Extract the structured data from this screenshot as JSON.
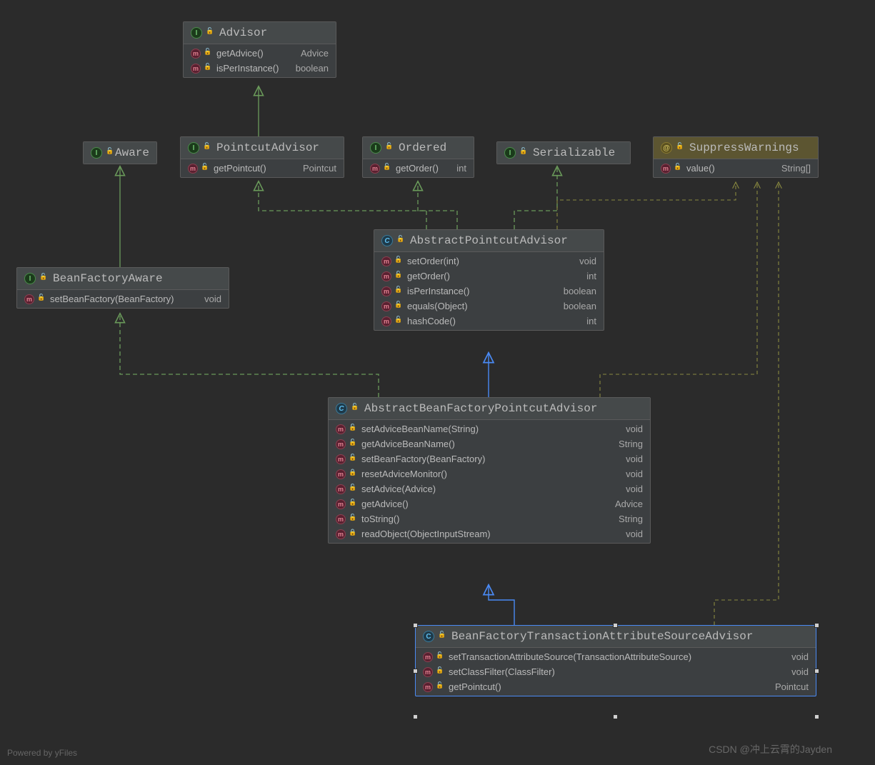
{
  "footer": {
    "powered": "Powered by yFiles"
  },
  "watermark": "CSDN @冲上云霄的Jayden",
  "classes": {
    "advisor": {
      "name": "Advisor",
      "kind": "interface",
      "members": [
        {
          "name": "getAdvice()",
          "type": "Advice",
          "access": "open"
        },
        {
          "name": "isPerInstance()",
          "type": "boolean",
          "access": "open"
        }
      ]
    },
    "aware": {
      "name": "Aware",
      "kind": "interface",
      "members": []
    },
    "pointcutAdvisor": {
      "name": "PointcutAdvisor",
      "kind": "interface",
      "members": [
        {
          "name": "getPointcut()",
          "type": "Pointcut",
          "access": "open"
        }
      ]
    },
    "ordered": {
      "name": "Ordered",
      "kind": "interface",
      "members": [
        {
          "name": "getOrder()",
          "type": "int",
          "access": "open"
        }
      ]
    },
    "serializable": {
      "name": "Serializable",
      "kind": "interface",
      "members": []
    },
    "suppressWarnings": {
      "name": "SuppressWarnings",
      "kind": "annotation",
      "members": [
        {
          "name": "value()",
          "type": "String[]",
          "access": "open"
        }
      ]
    },
    "beanFactoryAware": {
      "name": "BeanFactoryAware",
      "kind": "interface",
      "members": [
        {
          "name": "setBeanFactory(BeanFactory)",
          "type": "void",
          "access": "open"
        }
      ]
    },
    "abstractPointcutAdvisor": {
      "name": "AbstractPointcutAdvisor",
      "kind": "abstract-class",
      "members": [
        {
          "name": "setOrder(int)",
          "type": "void",
          "access": "open"
        },
        {
          "name": "getOrder()",
          "type": "int",
          "access": "open"
        },
        {
          "name": "isPerInstance()",
          "type": "boolean",
          "access": "open"
        },
        {
          "name": "equals(Object)",
          "type": "boolean",
          "access": "open"
        },
        {
          "name": "hashCode()",
          "type": "int",
          "access": "open"
        }
      ]
    },
    "abstractBeanFactoryPointcutAdvisor": {
      "name": "AbstractBeanFactoryPointcutAdvisor",
      "kind": "abstract-class",
      "members": [
        {
          "name": "setAdviceBeanName(String)",
          "type": "void",
          "access": "open"
        },
        {
          "name": "getAdviceBeanName()",
          "type": "String",
          "access": "open"
        },
        {
          "name": "setBeanFactory(BeanFactory)",
          "type": "void",
          "access": "open"
        },
        {
          "name": "resetAdviceMonitor()",
          "type": "void",
          "access": "locked"
        },
        {
          "name": "setAdvice(Advice)",
          "type": "void",
          "access": "open"
        },
        {
          "name": "getAdvice()",
          "type": "Advice",
          "access": "open"
        },
        {
          "name": "toString()",
          "type": "String",
          "access": "open"
        },
        {
          "name": "readObject(ObjectInputStream)",
          "type": "void",
          "access": "locked"
        }
      ]
    },
    "beanFactoryTransactionAttributeSourceAdvisor": {
      "name": "BeanFactoryTransactionAttributeSourceAdvisor",
      "kind": "class",
      "members": [
        {
          "name": "setTransactionAttributeSource(TransactionAttributeSource)",
          "type": "void",
          "access": "open"
        },
        {
          "name": "setClassFilter(ClassFilter)",
          "type": "void",
          "access": "open"
        },
        {
          "name": "getPointcut()",
          "type": "Pointcut",
          "access": "open"
        }
      ]
    }
  }
}
